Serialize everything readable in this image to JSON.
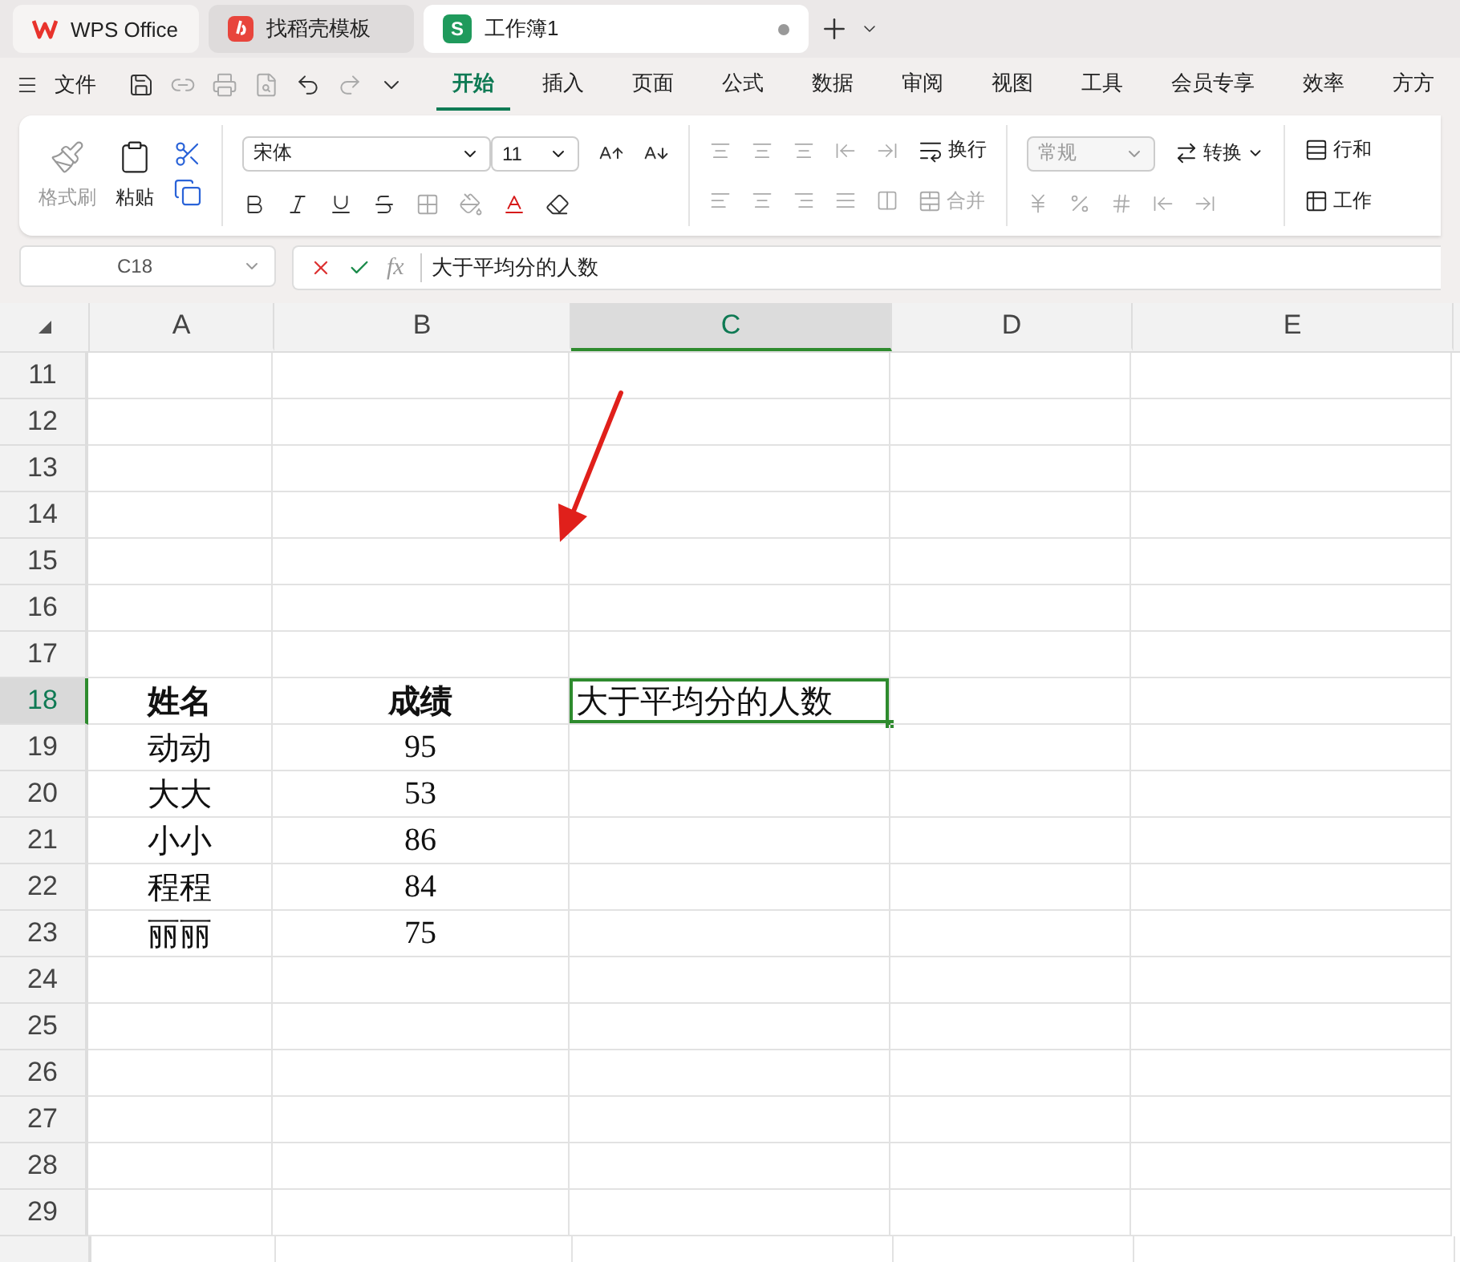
{
  "tabs": [
    {
      "label": "WPS Office",
      "kind": "home",
      "selected": false
    },
    {
      "label": "找稻壳模板",
      "kind": "template",
      "selected": false
    },
    {
      "label": "工作簿1",
      "kind": "sheet",
      "badge": "S",
      "selected": true
    }
  ],
  "menu": {
    "file_label": "文件",
    "ribbon_tabs": [
      {
        "label": "开始",
        "selected": true
      },
      {
        "label": "插入",
        "selected": false
      },
      {
        "label": "页面",
        "selected": false
      },
      {
        "label": "公式",
        "selected": false
      },
      {
        "label": "数据",
        "selected": false
      },
      {
        "label": "审阅",
        "selected": false
      },
      {
        "label": "视图",
        "selected": false
      },
      {
        "label": "工具",
        "selected": false
      },
      {
        "label": "会员专享",
        "selected": false
      },
      {
        "label": "效率",
        "selected": false
      },
      {
        "label": "方方",
        "selected": false
      }
    ]
  },
  "ribbon": {
    "format_painter": {
      "label": "格式刷",
      "disabled": true
    },
    "paste": "粘贴",
    "font": "宋体",
    "font_size": "11",
    "wrap": "换行",
    "merge": {
      "label": "合并",
      "disabled": true
    },
    "number_format": {
      "label": "常规",
      "disabled": true
    },
    "convert": "转换",
    "rows_cols": "行和",
    "worksheet": "工作"
  },
  "name_box": "C18",
  "function_label": "fx",
  "formula": "大于平均分的人数",
  "columns": [
    {
      "label": "A",
      "selected": false
    },
    {
      "label": "B",
      "selected": false
    },
    {
      "label": "C",
      "selected": true
    },
    {
      "label": "D",
      "selected": false
    },
    {
      "label": "E",
      "selected": false
    }
  ],
  "rows": [
    {
      "number": "11",
      "selected": false
    },
    {
      "number": "12",
      "selected": false
    },
    {
      "number": "13",
      "selected": false
    },
    {
      "number": "14",
      "selected": false
    },
    {
      "number": "15",
      "selected": false
    },
    {
      "number": "16",
      "selected": false
    },
    {
      "number": "17",
      "selected": false
    },
    {
      "number": "18",
      "selected": true,
      "cells": {
        "a": {
          "text": "姓名",
          "bold": true
        },
        "b": {
          "text": "成绩",
          "bold": true
        },
        "c": {
          "text": "大于平均分的人数",
          "active": true
        }
      }
    },
    {
      "number": "19",
      "selected": false,
      "cells": {
        "a": {
          "text": "动动"
        },
        "b": {
          "text": "95"
        }
      }
    },
    {
      "number": "20",
      "selected": false,
      "cells": {
        "a": {
          "text": "大大"
        },
        "b": {
          "text": "53"
        }
      }
    },
    {
      "number": "21",
      "selected": false,
      "cells": {
        "a": {
          "text": "小小"
        },
        "b": {
          "text": "86"
        }
      }
    },
    {
      "number": "22",
      "selected": false,
      "cells": {
        "a": {
          "text": "程程"
        },
        "b": {
          "text": "84"
        }
      }
    },
    {
      "number": "23",
      "selected": false,
      "cells": {
        "a": {
          "text": "丽丽"
        },
        "b": {
          "text": "75"
        }
      }
    },
    {
      "number": "24",
      "selected": false
    },
    {
      "number": "25",
      "selected": false
    },
    {
      "number": "26",
      "selected": false
    },
    {
      "number": "27",
      "selected": false
    },
    {
      "number": "28",
      "selected": false
    },
    {
      "number": "29",
      "selected": false
    }
  ]
}
